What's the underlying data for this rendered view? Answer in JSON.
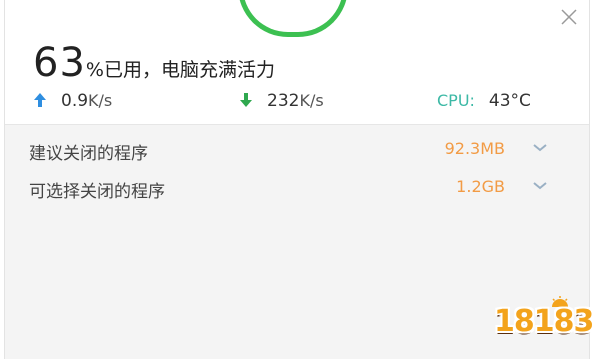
{
  "header": {
    "close_icon": "close-icon",
    "mascot_icon": "green-face-mascot"
  },
  "usage": {
    "percent": "63",
    "unit": "%",
    "text": "已用，电脑充满活力"
  },
  "network": {
    "upload": {
      "icon": "arrow-up-icon",
      "value": "0.9",
      "unit": "K/s",
      "color": "#2f8ee0"
    },
    "download": {
      "icon": "arrow-down-icon",
      "value": "232",
      "unit": "K/s",
      "color": "#2fa84f"
    }
  },
  "cpu": {
    "label": "CPU:",
    "temperature": "43°C",
    "label_color": "#3db9a6"
  },
  "programs": [
    {
      "label": "建议关闭的程序",
      "size": "92.3MB",
      "icon": "chevron-down-icon"
    },
    {
      "label": "可选择关闭的程序",
      "size": "1.2GB",
      "icon": "chevron-down-icon"
    }
  ],
  "watermark": {
    "text": "18183"
  },
  "colors": {
    "accent_green": "#3cc051",
    "size_orange": "#f29b45",
    "list_background": "#f4f4f4"
  }
}
